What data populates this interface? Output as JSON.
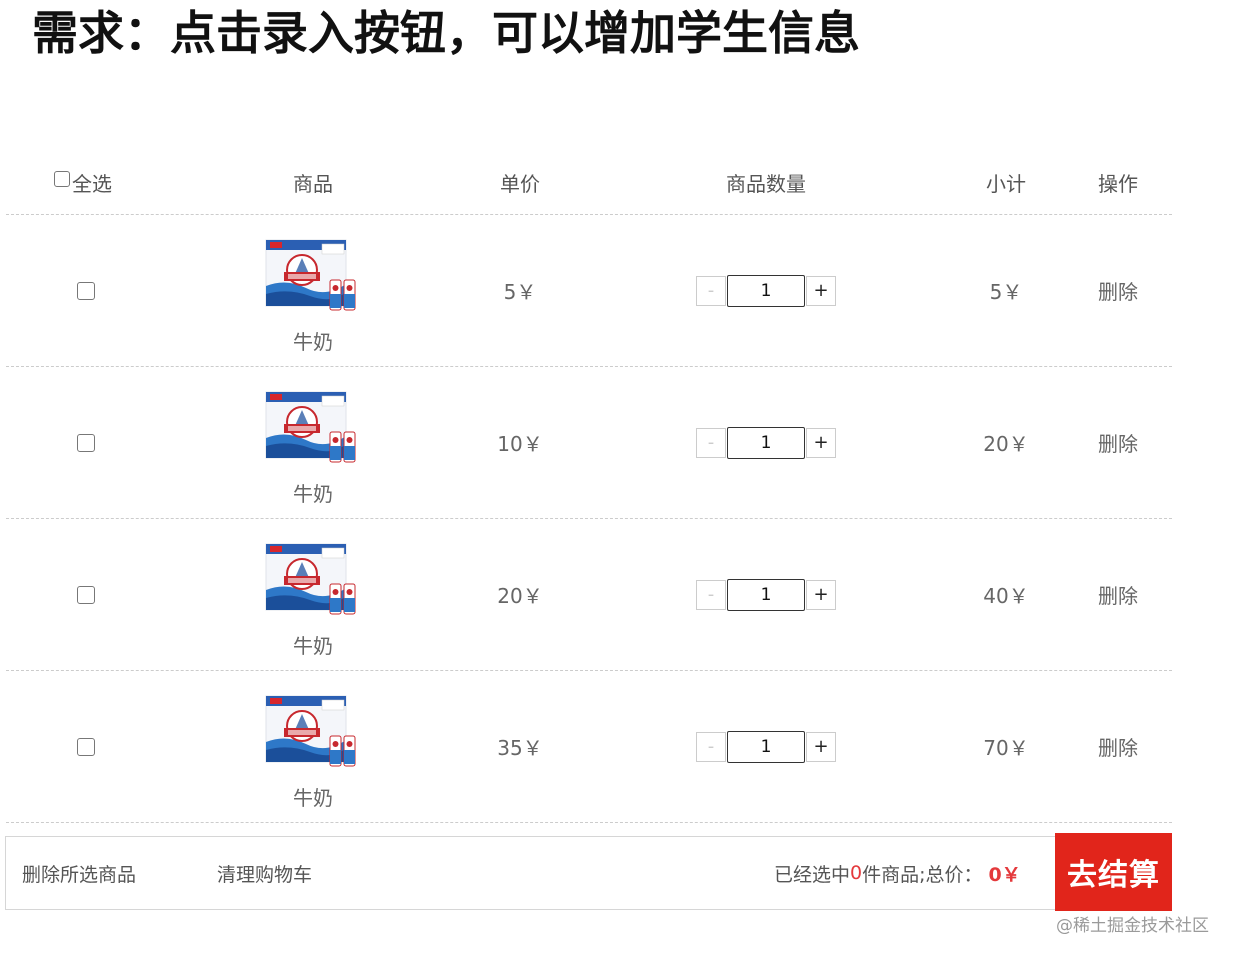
{
  "heading": "需求：点击录入按钮，可以增加学生信息",
  "table": {
    "headers": {
      "select_all": "全选",
      "goods": "商品",
      "price": "单价",
      "quantity": "商品数量",
      "subtotal": "小计",
      "operation": "操作"
    },
    "rows": [
      {
        "name": "牛奶",
        "price": "5￥",
        "quantity": "1",
        "subtotal": "5￥",
        "delete": "删除"
      },
      {
        "name": "牛奶",
        "price": "10￥",
        "quantity": "1",
        "subtotal": "20￥",
        "delete": "删除"
      },
      {
        "name": "牛奶",
        "price": "20￥",
        "quantity": "1",
        "subtotal": "40￥",
        "delete": "删除"
      },
      {
        "name": "牛奶",
        "price": "35￥",
        "quantity": "1",
        "subtotal": "70￥",
        "delete": "删除"
      }
    ],
    "stepper": {
      "minus": "-",
      "plus": "+"
    }
  },
  "footer": {
    "delete_selected": "删除所选商品",
    "clear_cart": "清理购物车",
    "selected_prefix": "已经选中",
    "selected_count": "0",
    "selected_suffix": "件商品;总价：",
    "total": "0￥",
    "checkout": "去结算"
  },
  "watermark": "@稀土掘金技术社区",
  "colors": {
    "accent_red": "#e1251b",
    "price_red": "#e4393c",
    "divider": "#cccccc"
  },
  "icons": {
    "product_image": "milk-box-image"
  }
}
